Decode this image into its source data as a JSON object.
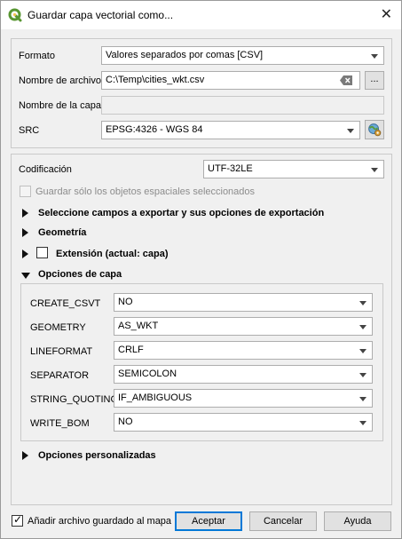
{
  "window": {
    "title": "Guardar capa vectorial como...",
    "close_glyph": "✕"
  },
  "fields": {
    "format": {
      "label": "Formato",
      "value": "Valores separados por comas [CSV]"
    },
    "filename": {
      "label": "Nombre de archivo",
      "value": "C:\\Temp\\cities_wkt.csv",
      "browse_label": "..."
    },
    "layername": {
      "label": "Nombre de la capa",
      "value": ""
    },
    "src": {
      "label": "SRC",
      "value": "EPSG:4326 - WGS 84"
    }
  },
  "encoding": {
    "label": "Codificación",
    "value": "UTF-32LE"
  },
  "only_selected": {
    "label": "Guardar sólo los objetos espaciales seleccionados",
    "checked": false
  },
  "sections": {
    "select_fields": "Seleccione campos a exportar y sus opciones de exportación",
    "geometry": "Geometría",
    "extent": "Extensión (actual: capa)",
    "layer_options": "Opciones de capa",
    "custom_options": "Opciones personalizadas"
  },
  "layer_options": [
    {
      "key": "CREATE_CSVT",
      "value": "NO"
    },
    {
      "key": "GEOMETRY",
      "value": "AS_WKT"
    },
    {
      "key": "LINEFORMAT",
      "value": "CRLF"
    },
    {
      "key": "SEPARATOR",
      "value": "SEMICOLON"
    },
    {
      "key": "STRING_QUOTING",
      "value": "IF_AMBIGUOUS"
    },
    {
      "key": "WRITE_BOM",
      "value": "NO"
    }
  ],
  "footer": {
    "add_to_map": {
      "label": "Añadir archivo guardado al mapa",
      "checked": true
    },
    "accept": "Aceptar",
    "cancel": "Cancelar",
    "help": "Ayuda"
  },
  "colors": {
    "qgis_green": "#589632",
    "accent_blue": "#0078d7"
  }
}
